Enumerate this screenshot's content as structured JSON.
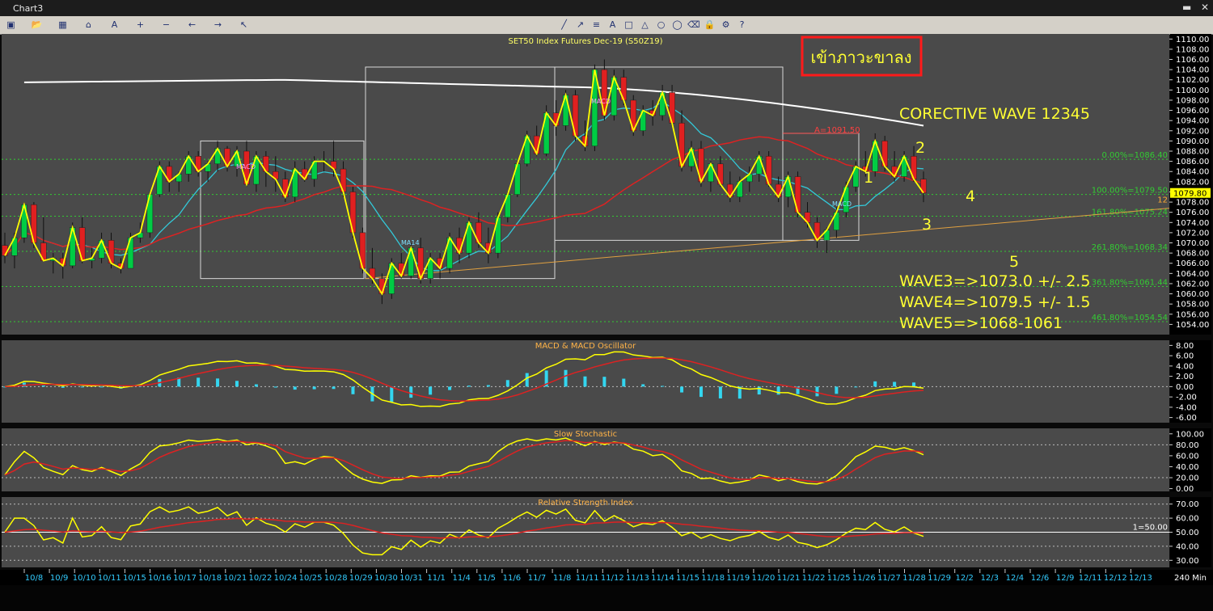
{
  "window": {
    "title": "Chart3"
  },
  "toolbar": {
    "icons": [
      "save-icon",
      "open-icon",
      "grid-icon",
      "home-icon",
      "text-icon",
      "zoom-in-icon",
      "zoom-out-icon",
      "arrow-left-icon",
      "arrow-right-icon",
      "cursor-icon",
      "line-icon",
      "ray-icon",
      "fib-icon",
      "text-tool-icon",
      "rect-icon",
      "triangle-icon",
      "circle-icon",
      "ellipse-icon",
      "eraser-icon",
      "lock-icon",
      "settings-icon",
      "help-icon"
    ]
  },
  "colors": {
    "bg": "#4a4a4a",
    "bull": "#00cc44",
    "bear": "#e02020",
    "price": "#ffff00",
    "ma_white": "#ffffff",
    "ma_red": "#dd2222",
    "ma_cyan": "#33c9d9",
    "trend": "#e0a040",
    "fib": "#33cc33",
    "frame": "#d8d8d8"
  },
  "main": {
    "title": "SET50 Index Futures Dec-19 (S50Z19)",
    "banner_text": "เข้าภาวะขาลง",
    "corrective_label": "CORECTIVE WAVE 12345",
    "price_label": "1079.80",
    "side_mark": "12",
    "wave_numbers": [
      "1",
      "2",
      "3",
      "4",
      "5"
    ],
    "forecast_lines": [
      "WAVE3=>1073.0 +/- 2.5",
      "WAVE4=>1079.5 +/- 1.5",
      "WAVE5=>1068-1061"
    ],
    "a_label": "A=1091.50",
    "macd_marker": "MACD",
    "ma_marker": "MA14",
    "y_ticks": [
      1110,
      1108,
      1106,
      1104,
      1102,
      1100,
      1098,
      1096,
      1094,
      1092,
      1090,
      1088,
      1086,
      1084,
      1082,
      1080,
      1078,
      1076,
      1074,
      1072,
      1070,
      1068,
      1066,
      1064,
      1062,
      1060,
      1058,
      1056,
      1054
    ],
    "fib_levels": [
      {
        "label": "0.00%=1086.40",
        "value": 1086.4
      },
      {
        "label": "100.00%=1079.50",
        "value": 1079.5
      },
      {
        "label": "161.80%=1075.24",
        "value": 1075.24
      },
      {
        "label": "261.80%=1068.34",
        "value": 1068.34
      },
      {
        "label": "361.80%=1061.44",
        "value": 1061.44
      },
      {
        "label": "461.80%=1054.54",
        "value": 1054.54
      }
    ]
  },
  "chart_data": {
    "type": "candlestick",
    "interval": "240 Min",
    "ylim": [
      1052,
      1111
    ],
    "candles": [
      [
        1069.5,
        1072,
        1066,
        1067.5
      ],
      [
        1067.5,
        1072,
        1065,
        1071
      ],
      [
        1071,
        1078,
        1070,
        1077.5
      ],
      [
        1077.5,
        1078,
        1069,
        1070
      ],
      [
        1070,
        1075,
        1067,
        1066.5
      ],
      [
        1066.5,
        1068,
        1064,
        1067
      ],
      [
        1067,
        1068,
        1063,
        1065.5
      ],
      [
        1065.5,
        1074,
        1065,
        1073
      ],
      [
        1073,
        1075,
        1066,
        1066.5
      ],
      [
        1066.5,
        1069,
        1065,
        1067
      ],
      [
        1067,
        1072,
        1066,
        1070.5
      ],
      [
        1070.5,
        1072,
        1065,
        1066
      ],
      [
        1066,
        1067,
        1064,
        1065
      ],
      [
        1065,
        1072,
        1065,
        1071
      ],
      [
        1071,
        1074,
        1070,
        1072
      ],
      [
        1072,
        1080,
        1071,
        1079.5
      ],
      [
        1079.5,
        1086,
        1079,
        1085
      ],
      [
        1085,
        1086,
        1080,
        1082
      ],
      [
        1082,
        1084,
        1080,
        1083.5
      ],
      [
        1083.5,
        1088,
        1082,
        1087
      ],
      [
        1087,
        1088,
        1083,
        1084
      ],
      [
        1084,
        1086,
        1082,
        1085.5
      ],
      [
        1085.5,
        1090,
        1084,
        1088.5
      ],
      [
        1088.5,
        1089,
        1084,
        1085
      ],
      [
        1085,
        1089,
        1083,
        1088
      ],
      [
        1088,
        1090,
        1081,
        1081.5
      ],
      [
        1081.5,
        1088,
        1080,
        1087
      ],
      [
        1087,
        1088,
        1081,
        1084
      ],
      [
        1084,
        1087,
        1080,
        1082.5
      ],
      [
        1082.5,
        1084,
        1078,
        1079
      ],
      [
        1079,
        1086,
        1078,
        1084.5
      ],
      [
        1084.5,
        1086,
        1082,
        1082.5
      ],
      [
        1082.5,
        1087,
        1081,
        1086
      ],
      [
        1086,
        1088,
        1084,
        1086
      ],
      [
        1086,
        1090,
        1083,
        1084.5
      ],
      [
        1084.5,
        1086,
        1079,
        1080
      ],
      [
        1080,
        1081,
        1071,
        1072
      ],
      [
        1072,
        1073,
        1064,
        1065
      ],
      [
        1065,
        1069,
        1062,
        1063
      ],
      [
        1063,
        1064,
        1058,
        1060
      ],
      [
        1060,
        1067,
        1059,
        1066
      ],
      [
        1066,
        1068,
        1063,
        1063.5
      ],
      [
        1063.5,
        1070,
        1063,
        1069
      ],
      [
        1069,
        1071,
        1062,
        1063
      ],
      [
        1063,
        1068,
        1062,
        1067
      ],
      [
        1067,
        1068,
        1063,
        1065
      ],
      [
        1065,
        1072,
        1064,
        1071
      ],
      [
        1071,
        1073,
        1066,
        1068
      ],
      [
        1068,
        1075,
        1067,
        1074
      ],
      [
        1074,
        1076,
        1069,
        1070
      ],
      [
        1070,
        1073,
        1066,
        1068
      ],
      [
        1068,
        1076,
        1067,
        1075
      ],
      [
        1075,
        1080,
        1074,
        1079.5
      ],
      [
        1079.5,
        1086,
        1079,
        1085.5
      ],
      [
        1085.5,
        1092,
        1085,
        1091
      ],
      [
        1091,
        1093,
        1087,
        1087.5
      ],
      [
        1087.5,
        1097,
        1087,
        1095.5
      ],
      [
        1095.5,
        1098,
        1091,
        1093
      ],
      [
        1093,
        1100,
        1092,
        1099
      ],
      [
        1099,
        1100,
        1090,
        1091
      ],
      [
        1091,
        1094,
        1088,
        1089
      ],
      [
        1089,
        1105,
        1088,
        1104
      ],
      [
        1104,
        1106,
        1094,
        1095
      ],
      [
        1095,
        1104,
        1094,
        1102.5
      ],
      [
        1102.5,
        1104,
        1097,
        1098
      ],
      [
        1098,
        1099,
        1091,
        1092
      ],
      [
        1092,
        1097,
        1091,
        1096
      ],
      [
        1096,
        1098,
        1093,
        1095
      ],
      [
        1095,
        1101,
        1094,
        1099.5
      ],
      [
        1099.5,
        1101,
        1093,
        1093.5
      ],
      [
        1093.5,
        1096,
        1084,
        1085
      ],
      [
        1085,
        1090,
        1084,
        1088.5
      ],
      [
        1088.5,
        1090,
        1081,
        1082
      ],
      [
        1082,
        1086,
        1080,
        1085.5
      ],
      [
        1085.5,
        1087,
        1081,
        1081.5
      ],
      [
        1081.5,
        1084,
        1078,
        1079
      ],
      [
        1079,
        1083,
        1078,
        1082
      ],
      [
        1082,
        1085,
        1080,
        1083.5
      ],
      [
        1083.5,
        1088,
        1082,
        1087
      ],
      [
        1087,
        1088,
        1081,
        1081.5
      ],
      [
        1081.5,
        1083,
        1078,
        1079
      ],
      [
        1079,
        1084,
        1077,
        1083
      ],
      [
        1083,
        1084,
        1075,
        1076
      ],
      [
        1076,
        1078,
        1073,
        1074
      ],
      [
        1074,
        1075,
        1069,
        1070.5
      ],
      [
        1070.5,
        1073,
        1068,
        1072.5
      ],
      [
        1072.5,
        1077,
        1071,
        1076
      ],
      [
        1076,
        1082,
        1075,
        1081
      ],
      [
        1081,
        1086,
        1080,
        1085
      ],
      [
        1085,
        1088,
        1083,
        1084
      ],
      [
        1084,
        1091.5,
        1083,
        1090
      ],
      [
        1090,
        1091,
        1084,
        1085
      ],
      [
        1085,
        1088,
        1082,
        1083
      ],
      [
        1083,
        1088,
        1082,
        1087
      ],
      [
        1087,
        1089,
        1082,
        1082.5
      ],
      [
        1082.5,
        1084,
        1078,
        1079.8
      ]
    ],
    "x_labels": [
      "10/8",
      "10/9",
      "10/10",
      "10/11",
      "10/15",
      "10/16",
      "10/17",
      "10/18",
      "10/21",
      "10/22",
      "10/24",
      "10/25",
      "10/28",
      "10/29",
      "10/30",
      "10/31",
      "11/1",
      "11/4",
      "11/5",
      "11/6",
      "11/7",
      "11/8",
      "11/11",
      "11/12",
      "11/13",
      "11/14",
      "11/15",
      "11/18",
      "11/19",
      "11/20",
      "11/21",
      "11/22",
      "11/25",
      "11/26",
      "11/27",
      "11/28",
      "11/29",
      "12/2",
      "12/3",
      "12/4",
      "12/6",
      "12/9",
      "12/11",
      "12/12",
      "12/13"
    ],
    "indicators": [
      {
        "title": "MACD & MACD Oscillator",
        "ticks": [
          "8.00",
          "6.00",
          "4.00",
          "2.00",
          "0.00",
          "-2.00",
          "-4.00",
          "-6.00"
        ],
        "ylim": [
          -7,
          9
        ]
      },
      {
        "title": "Slow Stochastic",
        "ticks": [
          "100.00",
          "80.00",
          "60.00",
          "40.00",
          "20.00",
          "0.00"
        ],
        "ylim": [
          -5,
          110
        ]
      },
      {
        "title": "Relative Strength Index",
        "ticks": [
          "70.00",
          "60.00",
          "50.00",
          "40.00",
          "30.00"
        ],
        "ylim": [
          25,
          75
        ],
        "ref_label": "1=50.00"
      }
    ]
  }
}
